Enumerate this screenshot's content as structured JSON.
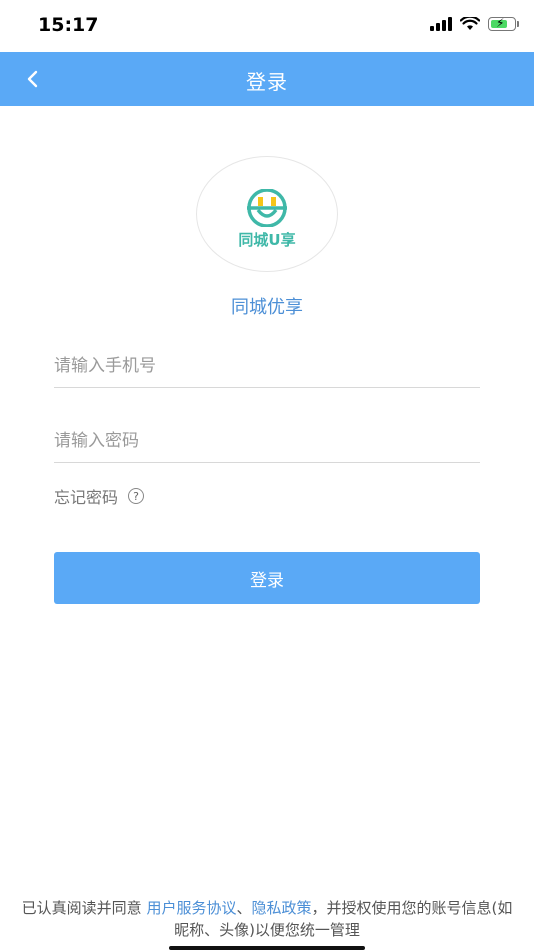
{
  "status_bar": {
    "time": "15:17",
    "icons": [
      "signal-icon",
      "wifi-icon",
      "battery-charging-icon"
    ]
  },
  "nav": {
    "title": "登录",
    "back_icon": "chevron-left-icon"
  },
  "logo": {
    "text": "同城U享"
  },
  "app_name": "同城优享",
  "form": {
    "phone_placeholder": "请输入手机号",
    "phone_value": "",
    "password_placeholder": "请输入密码",
    "password_value": "",
    "forgot_label": "忘记密码",
    "help_icon": "question-circle-icon",
    "login_label": "登录"
  },
  "agreement": {
    "prefix": "已认真阅读并同意 ",
    "user_agreement": "用户服务协议",
    "separator": "、",
    "privacy_policy": "隐私政策",
    "suffix": "，并授权使用您的账号信息(如昵称、头像)以便您统一管理"
  },
  "colors": {
    "primary": "#5aa9f6",
    "link": "#4c8fd6",
    "logo_teal": "#3fb8a8",
    "logo_yellow": "#f5c518"
  }
}
